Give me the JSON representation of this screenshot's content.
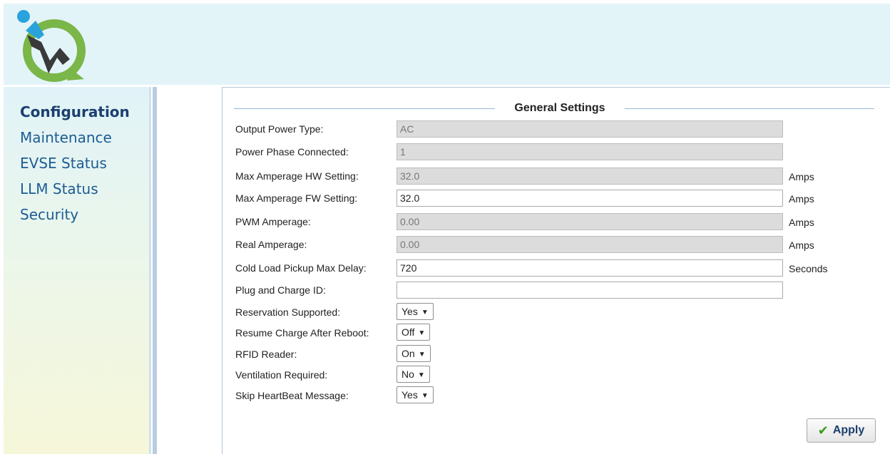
{
  "sidebar": {
    "items": [
      {
        "label": "Configuration",
        "active": true
      },
      {
        "label": "Maintenance",
        "active": false
      },
      {
        "label": "EVSE Status",
        "active": false
      },
      {
        "label": "LLM Status",
        "active": false
      },
      {
        "label": "Security",
        "active": false
      }
    ]
  },
  "general_settings": {
    "title": "General Settings",
    "output_power_type": {
      "label": "Output Power Type:",
      "value": "AC"
    },
    "power_phase_connected": {
      "label": "Power Phase Connected:",
      "value": "1"
    },
    "max_amperage_hw": {
      "label": "Max Amperage HW Setting:",
      "value": "32.0",
      "unit": "Amps"
    },
    "max_amperage_fw": {
      "label": "Max Amperage FW Setting:",
      "value": "32.0",
      "unit": "Amps"
    },
    "pwm_amperage": {
      "label": "PWM Amperage:",
      "value": "0.00",
      "unit": "Amps"
    },
    "real_amperage": {
      "label": "Real Amperage:",
      "value": "0.00",
      "unit": "Amps"
    },
    "cold_load_pickup": {
      "label": "Cold Load Pickup Max Delay:",
      "value": "720",
      "unit": "Seconds"
    },
    "plug_and_charge_id": {
      "label": "Plug and Charge ID:",
      "value": ""
    },
    "reservation_supported": {
      "label": "Reservation Supported:",
      "value": "Yes"
    },
    "resume_charge": {
      "label": "Resume Charge After Reboot:",
      "value": "Off"
    },
    "rfid_reader": {
      "label": "RFID Reader:",
      "value": "On"
    },
    "ventilation_required": {
      "label": "Ventilation Required:",
      "value": "No"
    },
    "skip_heartbeat": {
      "label": "Skip HeartBeat Message:",
      "value": "Yes"
    }
  },
  "apply_button": {
    "label": "Apply"
  },
  "colors": {
    "header_bg": "#e3f4f9",
    "nav_text": "#1d5c93",
    "accent_green": "#3a9a22"
  }
}
